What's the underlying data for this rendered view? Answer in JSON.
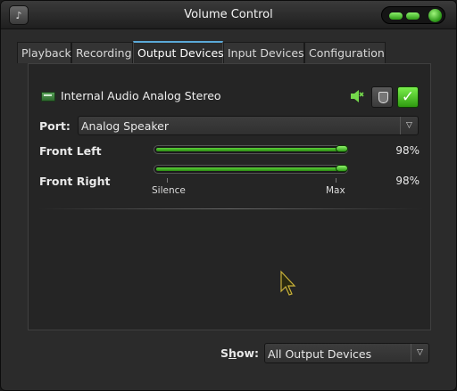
{
  "window": {
    "title": "Volume Control",
    "icon": "app-logo-icon"
  },
  "tabs": [
    {
      "label": "Playback",
      "active": false
    },
    {
      "label": "Recording",
      "active": false
    },
    {
      "label": "Output Devices",
      "active": true
    },
    {
      "label": "Input Devices",
      "active": false
    },
    {
      "label": "Configuration",
      "active": false
    }
  ],
  "device": {
    "name": "Internal Audio Analog Stereo",
    "icon": "sound-card-icon",
    "mute_icon": "mute-toggle-icon",
    "lock_icon": "lock-channels-icon",
    "default_icon": "checkmark-icon",
    "default_checked": true
  },
  "port": {
    "label": "Port:",
    "value": "Analog Speaker"
  },
  "channels": [
    {
      "label": "Front Left",
      "percent": "98%",
      "level": 0.98
    },
    {
      "label": "Front Right",
      "percent": "98%",
      "level": 0.98
    }
  ],
  "scale": {
    "min_label": "Silence",
    "max_label": "Max"
  },
  "show": {
    "label_prefix": "S",
    "label_accel": "h",
    "label_suffix": "ow:",
    "value": "All Output Devices"
  },
  "colors": {
    "accent": "#5cd13a",
    "tab_highlight": "#5aa9d8",
    "background": "#2b2b2b"
  }
}
